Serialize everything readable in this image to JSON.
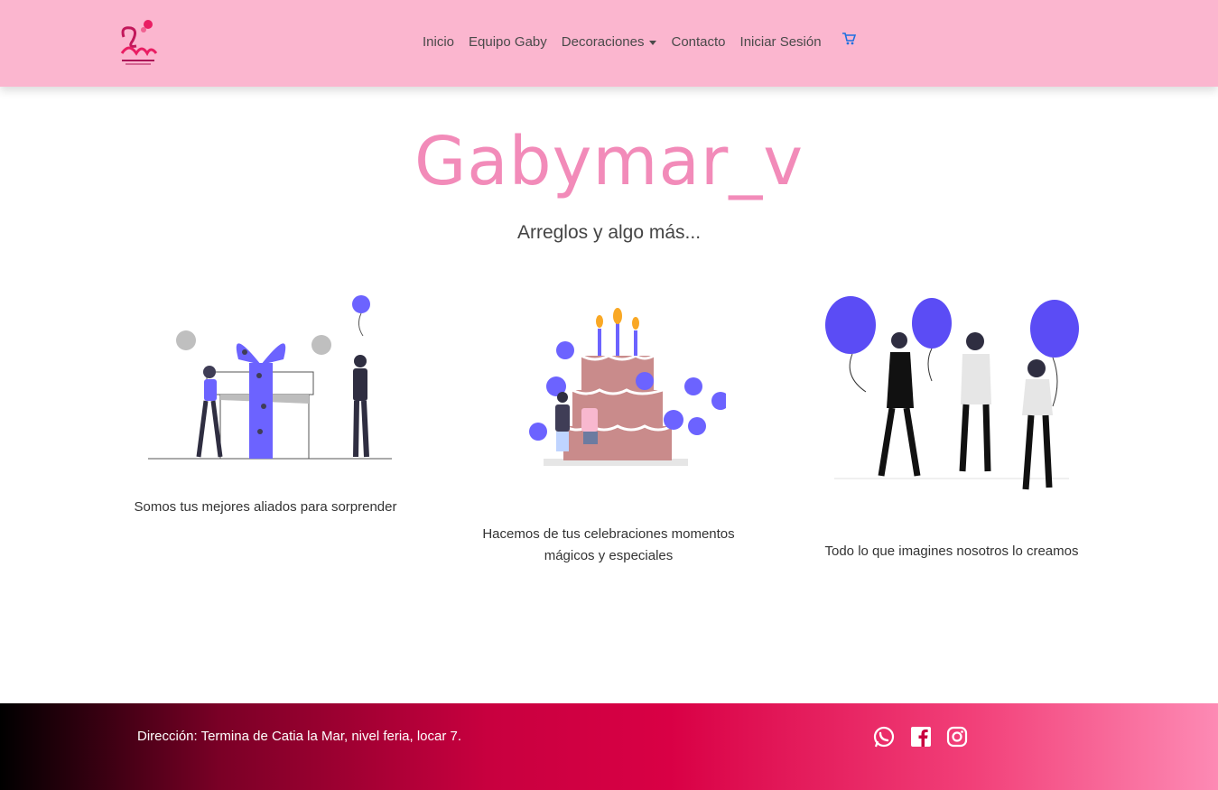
{
  "nav": {
    "logo_alt": "Gabymar logo",
    "links": [
      "Inicio",
      "Equipo Gaby",
      "Decoraciones",
      "Contacto",
      "Iniciar Sesión"
    ],
    "cart_icon": "cart-icon",
    "accent": "#fbb6cf"
  },
  "hero": {
    "title": "Gabymar_v",
    "subtitle": "Arreglos y algo más..."
  },
  "cards": [
    {
      "text": "Somos tus mejores aliados para sorprender",
      "icon": "gift-illustration"
    },
    {
      "text": "Hacemos de tus celebraciones momentos mágicos y especiales",
      "icon": "birthday-cake-illustration"
    },
    {
      "text": "Todo lo que imagines nosotros lo creamos",
      "icon": "balloons-party-illustration"
    }
  ],
  "footer": {
    "address": "Dirección: Termina de Catia la Mar, nivel feria, locar 7.",
    "social": [
      "whatsapp-icon",
      "facebook-icon",
      "instagram-icon"
    ]
  },
  "colors": {
    "title": "#f28bb9",
    "illustration": "#6c63ff",
    "cake": "#c98b8b"
  }
}
